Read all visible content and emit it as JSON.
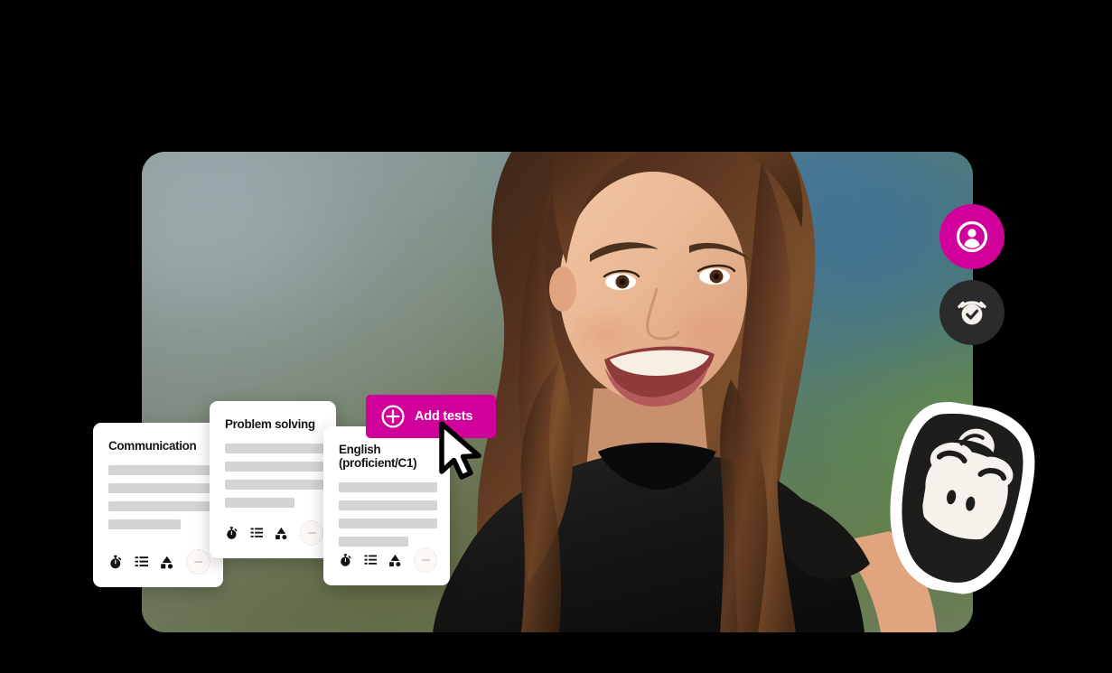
{
  "scene": {
    "background_color": "#000000",
    "accent_color": "#d1009a",
    "card_surface_color": "#ffffff",
    "skeleton_color": "#d4d4d4",
    "dark_button_color": "#2b2b2b"
  },
  "video_frame": {
    "name": "candidate-video-frame",
    "corner_radius_px": 26,
    "subject_alt": "Smiling woman with long brown curly hair wearing a black t-shirt"
  },
  "floating_actions": [
    {
      "id": "avatar",
      "icon": "user-circle-icon",
      "label": "Candidate profile",
      "background": "#d1009a",
      "icon_color": "#ffffff"
    },
    {
      "id": "timer",
      "icon": "alarm-clock-check-icon",
      "label": "Timed assessment",
      "background": "#2b2b2b",
      "icon_color": "#f6f1ea"
    }
  ],
  "brand": {
    "logo_name": "gorilla-head-logo",
    "logo_alt": "TestGorilla gorilla head mark",
    "fill": "#1d1d1b",
    "outline": "#ffffff"
  },
  "add_tests_button": {
    "label": "Add tests",
    "icon": "plus-circle-icon",
    "background": "#d1009a",
    "text_color": "#ffffff"
  },
  "cursor": {
    "name": "mouse-pointer",
    "fill": "#ffffff",
    "outline": "#000000"
  },
  "test_cards": [
    {
      "id": "communication",
      "title": "Communication",
      "title_lines": [
        "Communication"
      ],
      "skeleton_widths": [
        "w100",
        "w100",
        "w100",
        "w72"
      ],
      "icons": [
        "stopwatch-icon",
        "list-icon",
        "shapes-icon"
      ],
      "action_icon": "remove-test-icon"
    },
    {
      "id": "problem-solving",
      "title": "Problem solving",
      "title_lines": [
        "Problem solving"
      ],
      "skeleton_widths": [
        "w100",
        "w100",
        "w100",
        "w72"
      ],
      "icons": [
        "stopwatch-icon",
        "list-icon",
        "shapes-icon"
      ],
      "action_icon": "remove-test-icon"
    },
    {
      "id": "english",
      "title": "English (proficient/C1)",
      "title_lines": [
        "English",
        "(proficient/C1)"
      ],
      "skeleton_widths": [
        "w100",
        "w100",
        "w100",
        "w72"
      ],
      "icons": [
        "stopwatch-icon",
        "list-icon",
        "shapes-icon"
      ],
      "action_icon": "remove-test-icon"
    }
  ]
}
